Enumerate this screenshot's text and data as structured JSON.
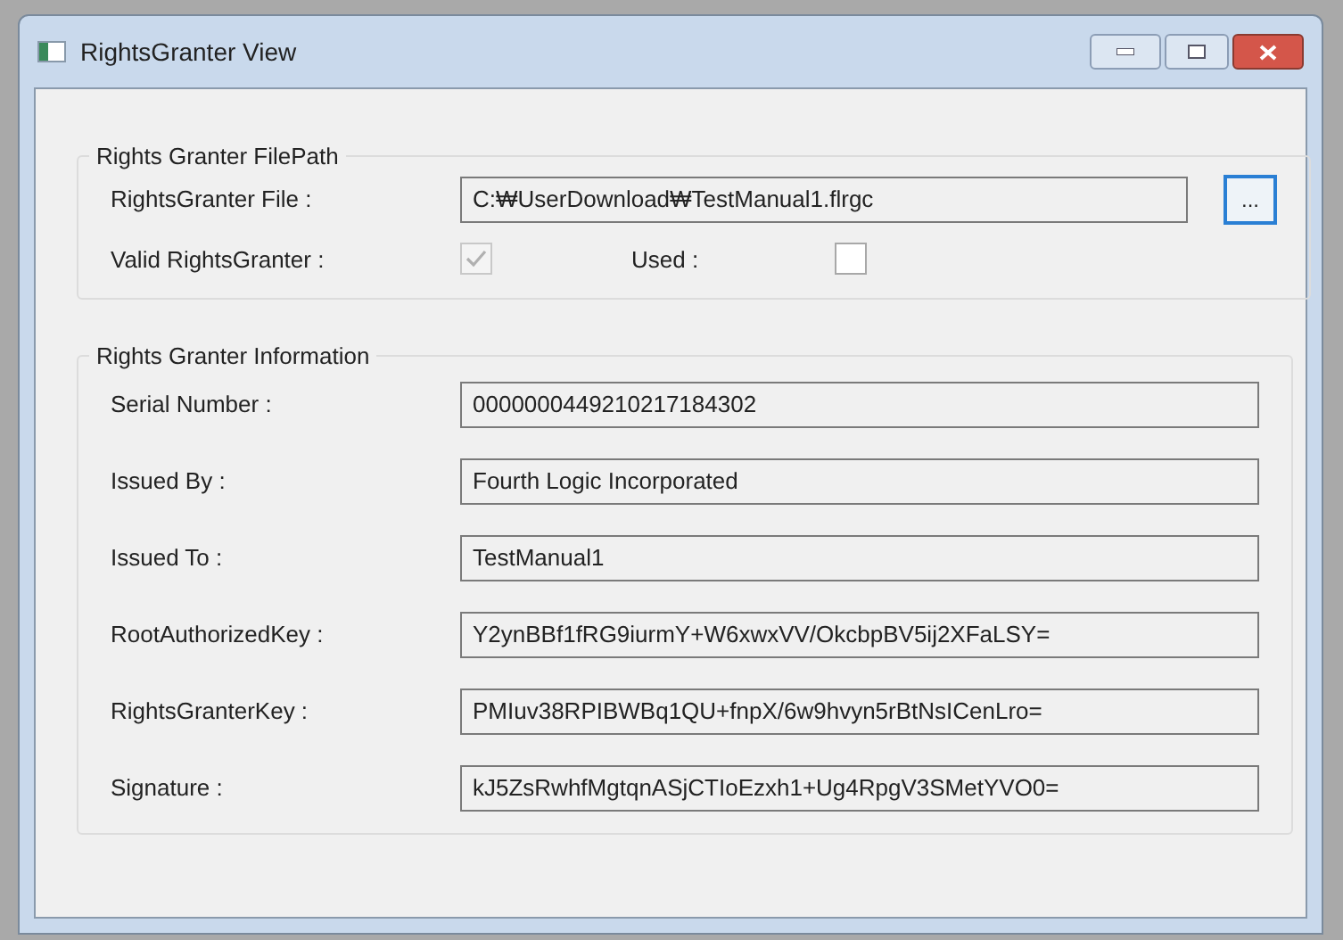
{
  "window": {
    "title": "RightsGranter View"
  },
  "file_group": {
    "title": "Rights Granter FilePath",
    "file_label": "RightsGranter File :",
    "file_value": "C:₩UserDownload₩TestManual1.flrgc",
    "browse_button": "...",
    "checks": [
      {
        "label": "Valid RightsGranter :",
        "checked": true,
        "disabled": true
      },
      {
        "label": "Used :",
        "checked": false,
        "disabled": false
      }
    ]
  },
  "info_group": {
    "title": "Rights Granter Information",
    "fields": [
      {
        "label": "Serial Number :",
        "value": "0000000449210217184302"
      },
      {
        "label": "Issued By :",
        "value": "Fourth Logic Incorporated"
      },
      {
        "label": "Issued To :",
        "value": "TestManual1"
      },
      {
        "label": "RootAuthorizedKey :",
        "value": "Y2ynBBf1fRG9iurmY+W6xwxVV/OkcbpBV5ij2XFaLSY="
      },
      {
        "label": "RightsGranterKey :",
        "value": "PMIuv38RPIBWBq1QU+fnpX/6w9hvyn5rBtNsICenLro="
      },
      {
        "label": "Signature :",
        "value": "kJ5ZsRwhfMgtqnASjCTIoEzxh1+Ug4RpgV3SMetYVO0="
      }
    ]
  }
}
